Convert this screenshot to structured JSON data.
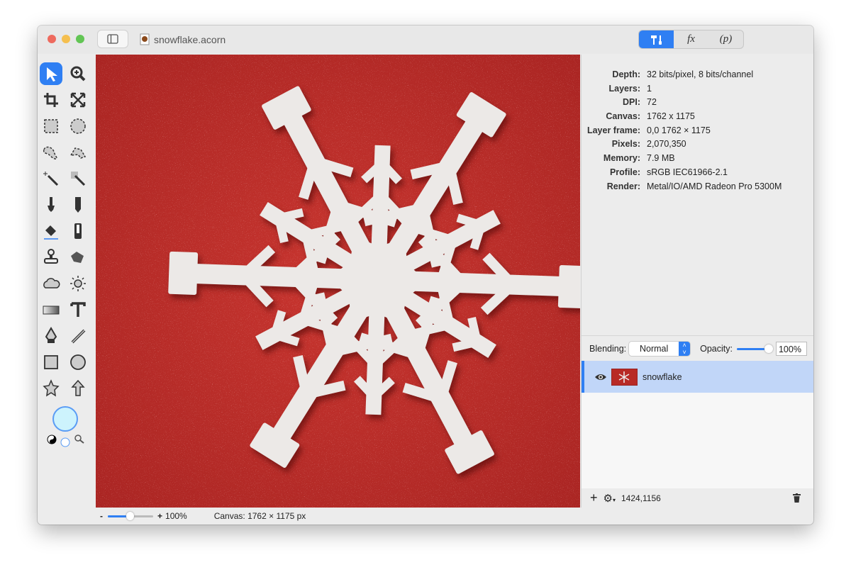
{
  "window": {
    "title": "snowflake.acorn",
    "traffic_colors": [
      "#ee6a5e",
      "#f5bf4f",
      "#62c554"
    ]
  },
  "toolbar": {
    "segments": [
      {
        "name": "tools",
        "label": ""
      },
      {
        "name": "filters",
        "label": "fx"
      },
      {
        "name": "plugins",
        "label": "(p)"
      }
    ],
    "accent": "#2f7ff3"
  },
  "tools": [
    "select-arrow",
    "zoom",
    "crop",
    "resize",
    "rect-select",
    "ellipse-select",
    "lasso",
    "polygon-lasso",
    "magic-wand",
    "color-select",
    "brush",
    "pencil",
    "eraser",
    "paint-bucket",
    "clone-stamp",
    "smudge",
    "cloud",
    "dodge-burn",
    "gradient",
    "text",
    "pen",
    "line",
    "rectangle",
    "circle",
    "star",
    "arrow"
  ],
  "info": [
    {
      "k": "Depth:",
      "v": "32 bits/pixel, 8 bits/channel"
    },
    {
      "k": "Layers:",
      "v": "1"
    },
    {
      "k": "DPI:",
      "v": "72"
    },
    {
      "k": "Canvas:",
      "v": "1762 x 1175"
    },
    {
      "k": "Layer frame:",
      "v": "0,0 1762 × 1175"
    },
    {
      "k": "Pixels:",
      "v": "2,070,350"
    },
    {
      "k": "Memory:",
      "v": "7.9 MB"
    },
    {
      "k": "Profile:",
      "v": "sRGB IEC61966-2.1"
    },
    {
      "k": "Render:",
      "v": "Metal/IO/AMD Radeon Pro 5300M"
    }
  ],
  "blending": {
    "label": "Blending:",
    "value": "Normal",
    "opacity_label": "Opacity:",
    "opacity": "100%",
    "opacity_fraction": 1.0
  },
  "layers": [
    {
      "name": "snowflake",
      "visible": true
    }
  ],
  "panel_footer": {
    "coords": "1424,1156"
  },
  "status": {
    "zoom": "100%",
    "zoom_fraction": 0.4,
    "canvas": "Canvas: 1762 × 1175 px",
    "minus": "-",
    "plus": "+"
  }
}
